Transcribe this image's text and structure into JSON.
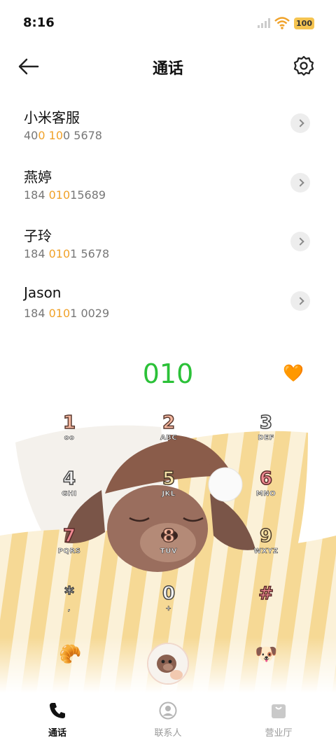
{
  "status_bar": {
    "time": "8:16",
    "battery": "100"
  },
  "header": {
    "title": "通话"
  },
  "contacts": [
    {
      "name": "小米客服",
      "number_parts": [
        "40",
        "0",
        " ",
        "10",
        "0 5678"
      ]
    },
    {
      "name": "燕婷",
      "number_parts": [
        "184 ",
        "010",
        "15689"
      ]
    },
    {
      "name": "子玲",
      "number_parts": [
        "184 ",
        "010",
        "1 5678"
      ]
    },
    {
      "name": "Jason",
      "number_parts": [
        "184 ",
        "010",
        "1 0029"
      ]
    }
  ],
  "dialer": {
    "display": "010",
    "keys": [
      {
        "digit": "1",
        "letters": "oo"
      },
      {
        "digit": "2",
        "letters": "ABC"
      },
      {
        "digit": "3",
        "letters": "DEF"
      },
      {
        "digit": "4",
        "letters": "GHI"
      },
      {
        "digit": "5",
        "letters": "JKL"
      },
      {
        "digit": "6",
        "letters": "MNO"
      },
      {
        "digit": "7",
        "letters": "PQRS"
      },
      {
        "digit": "8",
        "letters": "TUV"
      },
      {
        "digit": "9",
        "letters": "WXYZ"
      },
      {
        "digit": "*",
        "letters": ","
      },
      {
        "digit": "0",
        "letters": "+"
      },
      {
        "digit": "#",
        "letters": ""
      }
    ],
    "left_emoji": "🥐",
    "right_emoji": "🐶",
    "favorite_icon": "🧡"
  },
  "bottom_nav": {
    "items": [
      {
        "label": "通话",
        "icon": "phone-icon",
        "active": true
      },
      {
        "label": "联系人",
        "icon": "contact-icon",
        "active": false
      },
      {
        "label": "营业厅",
        "icon": "bag-icon",
        "active": false
      }
    ]
  },
  "colors": {
    "accent_green": "#2bc138",
    "highlight_orange": "#f0a22a",
    "battery": "#f5c451"
  }
}
